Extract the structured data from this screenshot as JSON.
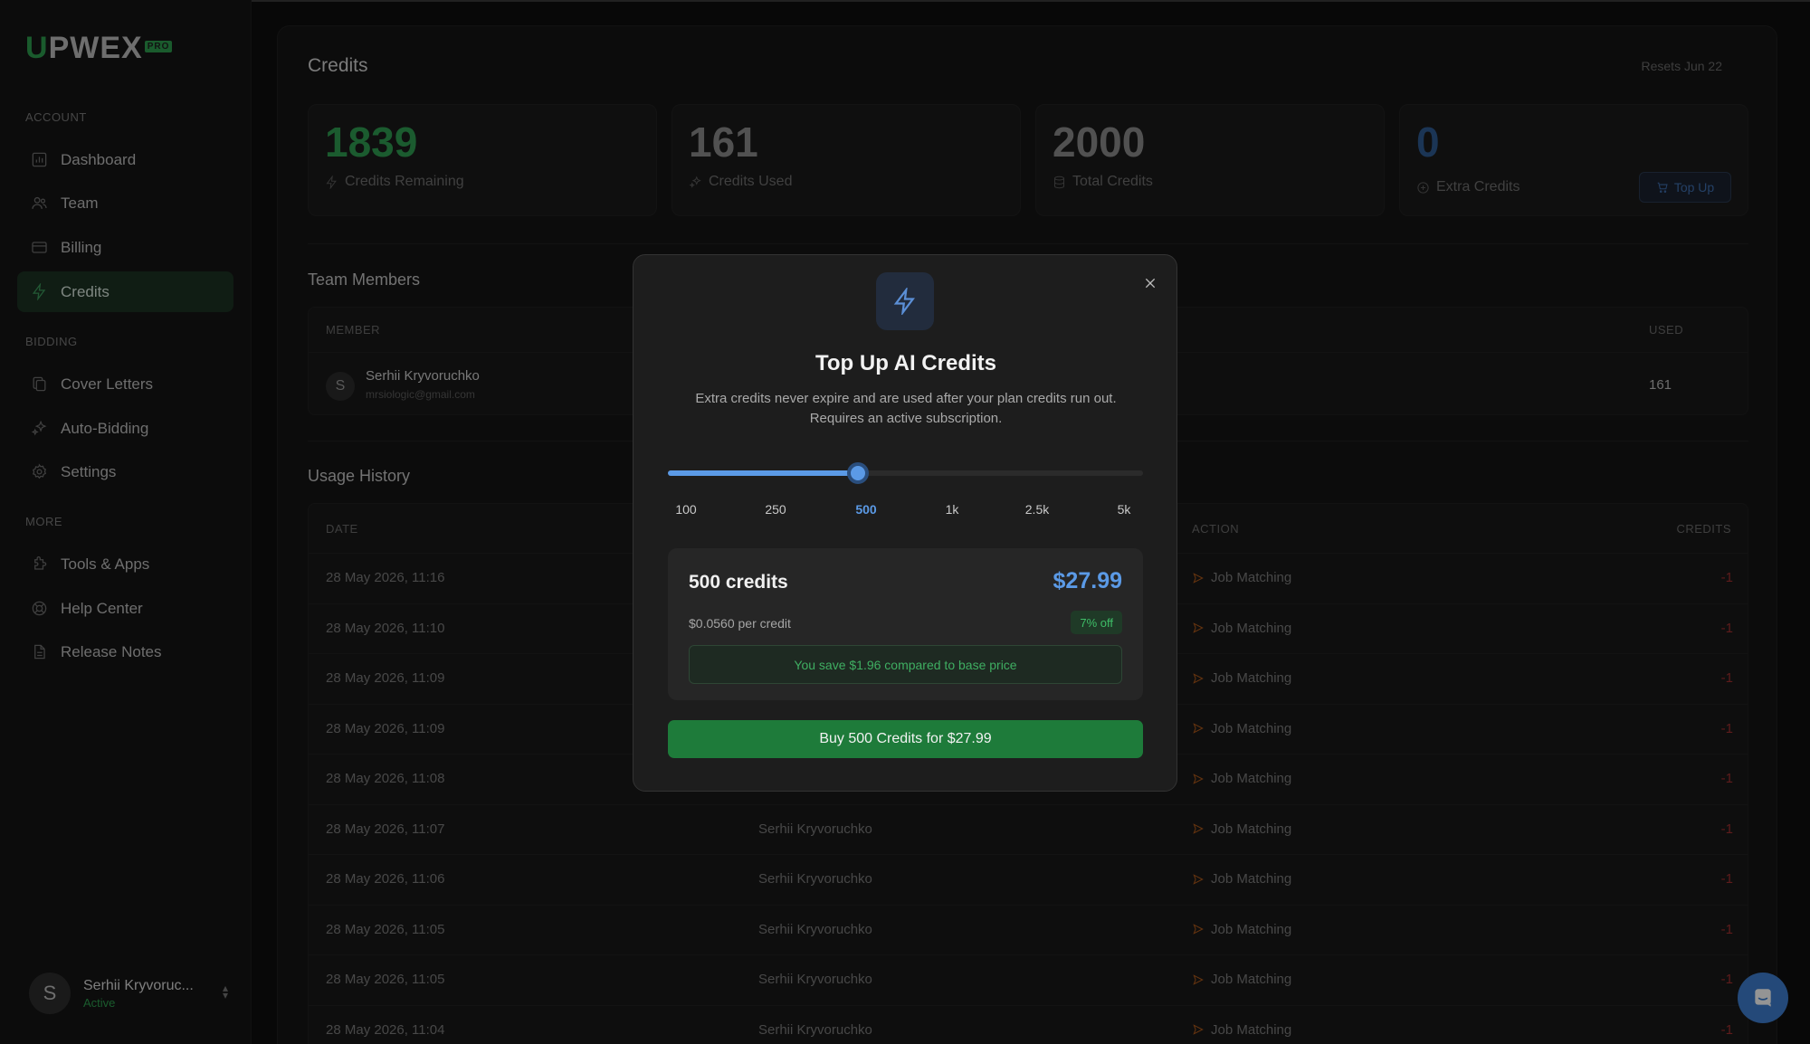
{
  "app": {
    "logo_u": "U",
    "logo_rest": "PWEX",
    "logo_badge": "PRO"
  },
  "sidebar": {
    "sections": {
      "account": "ACCOUNT",
      "bidding": "BIDDING",
      "more": "MORE"
    },
    "items": [
      {
        "label": "Dashboard",
        "icon": "chart-icon"
      },
      {
        "label": "Team",
        "icon": "users-icon"
      },
      {
        "label": "Billing",
        "icon": "card-icon"
      },
      {
        "label": "Credits",
        "icon": "bolt-icon",
        "active": true
      },
      {
        "label": "Cover Letters",
        "icon": "copy-icon"
      },
      {
        "label": "Auto-Bidding",
        "icon": "sparkles-icon"
      },
      {
        "label": "Settings",
        "icon": "gear-icon"
      },
      {
        "label": "Tools & Apps",
        "icon": "puzzle-icon"
      },
      {
        "label": "Help Center",
        "icon": "lifebuoy-icon"
      },
      {
        "label": "Release Notes",
        "icon": "document-icon"
      }
    ],
    "user": {
      "initial": "S",
      "name": "Serhii Kryvoruc...",
      "status": "Active"
    }
  },
  "credits": {
    "title": "Credits",
    "resets": "Resets Jun 22",
    "stats": [
      {
        "value": "1839",
        "label": "Credits Remaining"
      },
      {
        "value": "161",
        "label": "Credits Used"
      },
      {
        "value": "2000",
        "label": "Total Credits"
      },
      {
        "value": "0",
        "label": "Extra Credits"
      }
    ],
    "topup_label": "Top Up"
  },
  "team": {
    "title": "Team Members",
    "headers": {
      "member": "MEMBER",
      "used": "USED"
    },
    "member": {
      "initial": "S",
      "name": "Serhii Kryvoruchko",
      "email": "mrsiologic@gmail.com",
      "used": "161"
    }
  },
  "usage": {
    "title": "Usage History",
    "headers": {
      "date": "DATE",
      "action": "ACTION",
      "credits": "CREDITS"
    },
    "rows": [
      {
        "date": "28 May 2026, 11:16",
        "user": "",
        "action": "Job Matching",
        "credits": "-1"
      },
      {
        "date": "28 May 2026, 11:10",
        "user": "",
        "action": "Job Matching",
        "credits": "-1"
      },
      {
        "date": "28 May 2026, 11:09",
        "user": "",
        "action": "Job Matching",
        "credits": "-1"
      },
      {
        "date": "28 May 2026, 11:09",
        "user": "",
        "action": "Job Matching",
        "credits": "-1"
      },
      {
        "date": "28 May 2026, 11:08",
        "user": "",
        "action": "Job Matching",
        "credits": "-1"
      },
      {
        "date": "28 May 2026, 11:07",
        "user": "Serhii Kryvoruchko",
        "action": "Job Matching",
        "credits": "-1"
      },
      {
        "date": "28 May 2026, 11:06",
        "user": "Serhii Kryvoruchko",
        "action": "Job Matching",
        "credits": "-1"
      },
      {
        "date": "28 May 2026, 11:05",
        "user": "Serhii Kryvoruchko",
        "action": "Job Matching",
        "credits": "-1"
      },
      {
        "date": "28 May 2026, 11:05",
        "user": "Serhii Kryvoruchko",
        "action": "Job Matching",
        "credits": "-1"
      },
      {
        "date": "28 May 2026, 11:04",
        "user": "Serhii Kryvoruchko",
        "action": "Job Matching",
        "credits": "-1"
      }
    ]
  },
  "modal": {
    "title": "Top Up AI Credits",
    "description": "Extra credits never expire and are used after your plan credits run out. Requires an active subscription.",
    "slider": {
      "ticks": [
        "100",
        "250",
        "500",
        "1k",
        "2.5k",
        "5k"
      ],
      "selected_index": 2,
      "fill_fraction": 0.4
    },
    "summary": {
      "credits": "500 credits",
      "price": "$27.99",
      "per_credit": "$0.0560 per credit",
      "discount": "7% off",
      "savings": "You save $1.96 compared to base price"
    },
    "buy_label": "Buy 500 Credits for $27.99"
  },
  "colors": {
    "accent_green": "#2f9e52",
    "accent_blue": "#5b9ae6",
    "danger": "#a0302f"
  }
}
